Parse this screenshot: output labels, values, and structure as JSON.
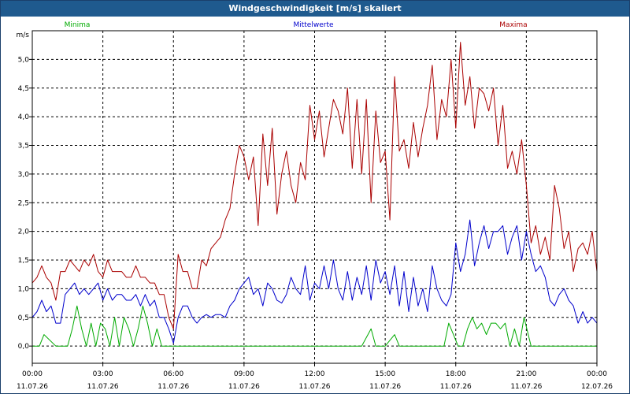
{
  "window": {
    "title": "Windgeschwindigkeit [m/s] skaliert"
  },
  "chart_data": {
    "type": "line",
    "title": "Windgeschwindigkeit [m/s] skaliert",
    "ylabel": "m/s",
    "ylim": [
      -0.3,
      5.5
    ],
    "xlim": [
      0,
      24
    ],
    "grid": true,
    "legend_placement": "top",
    "y_ticks": [
      "0,0",
      "0,5",
      "1,0",
      "1,5",
      "2,0",
      "2,5",
      "3,0",
      "3,5",
      "4,0",
      "4,5",
      "5,0"
    ],
    "x_ticks": [
      {
        "time": "00:00",
        "date": "11.07.26"
      },
      {
        "time": "03:00",
        "date": "11.07.26"
      },
      {
        "time": "06:00",
        "date": "11.07.26"
      },
      {
        "time": "09:00",
        "date": "11.07.26"
      },
      {
        "time": "12:00",
        "date": "11.07.26"
      },
      {
        "time": "15:00",
        "date": "11.07.26"
      },
      {
        "time": "18:00",
        "date": "11.07.26"
      },
      {
        "time": "21:00",
        "date": "11.07.26"
      },
      {
        "time": "00:00",
        "date": "12.07.26"
      }
    ],
    "series": [
      {
        "name": "Minima",
        "color": "#00aa00",
        "x": [
          0,
          0.3,
          0.5,
          1,
          1.5,
          1.7,
          1.9,
          2.1,
          2.3,
          2.5,
          2.7,
          2.9,
          3.1,
          3.3,
          3.5,
          3.7,
          3.9,
          4.1,
          4.3,
          4.5,
          4.7,
          4.9,
          5.1,
          5.3,
          5.5,
          5.7,
          5.9,
          6.1,
          7,
          10,
          14,
          14.4,
          14.6,
          15,
          15.4,
          15.6,
          16,
          17.5,
          17.7,
          17.9,
          18.1,
          18.3,
          18.5,
          18.7,
          18.9,
          19.1,
          19.3,
          19.5,
          19.7,
          19.9,
          20.1,
          20.3,
          20.5,
          20.7,
          20.9,
          21.2,
          22,
          24
        ],
        "y": [
          0,
          0,
          0.2,
          0,
          0,
          0.3,
          0.7,
          0.3,
          0,
          0.4,
          0,
          0.4,
          0.3,
          0,
          0.5,
          0,
          0.5,
          0.3,
          0,
          0.3,
          0.7,
          0.4,
          0,
          0.3,
          0,
          0,
          0,
          0,
          0,
          0,
          0,
          0.3,
          0,
          0,
          0.2,
          0,
          0,
          0,
          0.4,
          0.2,
          0,
          0,
          0.3,
          0.5,
          0.3,
          0.4,
          0.2,
          0.4,
          0.4,
          0.3,
          0.4,
          0,
          0.3,
          0,
          0.5,
          0,
          0,
          0
        ]
      },
      {
        "name": "Mittelwerte",
        "color": "#0000cc",
        "x": [
          0,
          0.2,
          0.4,
          0.6,
          0.8,
          1.0,
          1.2,
          1.4,
          1.6,
          1.8,
          2.0,
          2.2,
          2.4,
          2.6,
          2.8,
          3.0,
          3.2,
          3.4,
          3.6,
          3.8,
          4.0,
          4.2,
          4.4,
          4.6,
          4.8,
          5.0,
          5.2,
          5.4,
          5.6,
          5.8,
          6.0,
          6.2,
          6.4,
          6.6,
          6.8,
          7.0,
          7.2,
          7.4,
          7.6,
          7.8,
          8.0,
          8.2,
          8.4,
          8.6,
          8.8,
          9.0,
          9.2,
          9.4,
          9.6,
          9.8,
          10.0,
          10.2,
          10.4,
          10.6,
          10.8,
          11.0,
          11.2,
          11.4,
          11.6,
          11.8,
          12.0,
          12.2,
          12.4,
          12.6,
          12.8,
          13.0,
          13.2,
          13.4,
          13.6,
          13.8,
          14.0,
          14.2,
          14.4,
          14.6,
          14.8,
          15.0,
          15.2,
          15.4,
          15.6,
          15.8,
          16.0,
          16.2,
          16.4,
          16.6,
          16.8,
          17.0,
          17.2,
          17.4,
          17.6,
          17.8,
          18.0,
          18.2,
          18.4,
          18.6,
          18.8,
          19.0,
          19.2,
          19.4,
          19.6,
          19.8,
          20.0,
          20.2,
          20.4,
          20.6,
          20.8,
          21.0,
          21.2,
          21.4,
          21.6,
          21.8,
          22.0,
          22.2,
          22.4,
          22.6,
          22.8,
          23.0,
          23.2,
          23.4,
          23.6,
          23.8,
          24.0
        ],
        "y": [
          0.5,
          0.6,
          0.8,
          0.6,
          0.7,
          0.4,
          0.4,
          0.9,
          1.0,
          1.1,
          0.9,
          1.0,
          0.9,
          1.0,
          1.1,
          0.8,
          1.0,
          0.8,
          0.9,
          0.9,
          0.8,
          0.8,
          0.9,
          0.7,
          0.9,
          0.7,
          0.8,
          0.5,
          0.5,
          0.3,
          0.05,
          0.5,
          0.7,
          0.7,
          0.5,
          0.4,
          0.5,
          0.55,
          0.5,
          0.55,
          0.55,
          0.5,
          0.7,
          0.8,
          1.0,
          1.1,
          1.2,
          0.9,
          1.0,
          0.7,
          1.1,
          1.0,
          0.8,
          0.75,
          0.9,
          1.2,
          1.0,
          0.9,
          1.4,
          0.8,
          1.1,
          1.0,
          1.4,
          1.0,
          1.5,
          1.0,
          0.8,
          1.3,
          0.8,
          1.2,
          0.9,
          1.4,
          0.8,
          1.5,
          1.1,
          1.3,
          0.9,
          1.4,
          0.7,
          1.3,
          0.6,
          1.2,
          0.7,
          1.0,
          0.6,
          1.4,
          1.0,
          0.8,
          0.7,
          0.9,
          1.8,
          1.3,
          1.6,
          2.2,
          1.4,
          1.8,
          2.1,
          1.7,
          2.0,
          2.0,
          2.1,
          1.6,
          1.9,
          2.1,
          1.5,
          2.0,
          1.6,
          1.3,
          1.4,
          1.2,
          0.8,
          0.7,
          0.9,
          1.0,
          0.8,
          0.7,
          0.4,
          0.6,
          0.4,
          0.5,
          0.4
        ]
      },
      {
        "name": "Maxima",
        "color": "#aa0000",
        "x": [
          0,
          0.2,
          0.4,
          0.6,
          0.8,
          1.0,
          1.2,
          1.4,
          1.6,
          1.8,
          2.0,
          2.2,
          2.4,
          2.6,
          2.8,
          3.0,
          3.2,
          3.4,
          3.6,
          3.8,
          4.0,
          4.2,
          4.4,
          4.6,
          4.8,
          5.0,
          5.2,
          5.4,
          5.6,
          5.8,
          6.0,
          6.2,
          6.4,
          6.6,
          6.8,
          7.0,
          7.2,
          7.4,
          7.6,
          7.8,
          8.0,
          8.2,
          8.4,
          8.6,
          8.8,
          9.0,
          9.2,
          9.4,
          9.6,
          9.8,
          10.0,
          10.2,
          10.4,
          10.6,
          10.8,
          11.0,
          11.2,
          11.4,
          11.6,
          11.8,
          12.0,
          12.2,
          12.4,
          12.6,
          12.8,
          13.0,
          13.2,
          13.4,
          13.6,
          13.8,
          14.0,
          14.2,
          14.4,
          14.6,
          14.8,
          15.0,
          15.2,
          15.4,
          15.6,
          15.8,
          16.0,
          16.2,
          16.4,
          16.6,
          16.8,
          17.0,
          17.2,
          17.4,
          17.6,
          17.8,
          18.0,
          18.2,
          18.4,
          18.6,
          18.8,
          19.0,
          19.2,
          19.4,
          19.6,
          19.8,
          20.0,
          20.2,
          20.4,
          20.6,
          20.8,
          21.0,
          21.2,
          21.4,
          21.6,
          21.8,
          22.0,
          22.2,
          22.4,
          22.6,
          22.8,
          23.0,
          23.2,
          23.4,
          23.6,
          23.8,
          24.0
        ],
        "y": [
          1.1,
          1.2,
          1.4,
          1.2,
          1.1,
          0.8,
          1.3,
          1.3,
          1.5,
          1.4,
          1.3,
          1.5,
          1.4,
          1.6,
          1.3,
          1.2,
          1.5,
          1.3,
          1.3,
          1.3,
          1.2,
          1.2,
          1.4,
          1.2,
          1.2,
          1.1,
          1.1,
          0.9,
          0.9,
          0.5,
          0.3,
          1.6,
          1.3,
          1.3,
          1.0,
          1.0,
          1.5,
          1.4,
          1.7,
          1.8,
          1.9,
          2.2,
          2.4,
          3.0,
          3.5,
          3.3,
          2.9,
          3.3,
          2.1,
          3.7,
          2.8,
          3.8,
          2.3,
          3.0,
          3.4,
          2.8,
          2.5,
          3.2,
          2.9,
          4.2,
          3.6,
          4.1,
          3.3,
          3.8,
          4.3,
          4.1,
          3.7,
          4.5,
          3.1,
          4.3,
          3.0,
          4.3,
          2.5,
          4.1,
          3.2,
          3.4,
          2.2,
          4.7,
          3.4,
          3.6,
          3.1,
          3.9,
          3.3,
          3.8,
          4.2,
          4.9,
          3.6,
          4.3,
          4.0,
          5.0,
          3.8,
          5.3,
          4.2,
          4.7,
          3.8,
          4.5,
          4.4,
          4.1,
          4.5,
          3.5,
          4.2,
          3.1,
          3.4,
          3.0,
          3.6,
          2.8,
          1.8,
          2.1,
          1.6,
          1.9,
          1.5,
          2.8,
          2.4,
          1.7,
          2.0,
          1.3,
          1.7,
          1.8,
          1.6,
          2.0,
          1.3
        ]
      }
    ]
  }
}
